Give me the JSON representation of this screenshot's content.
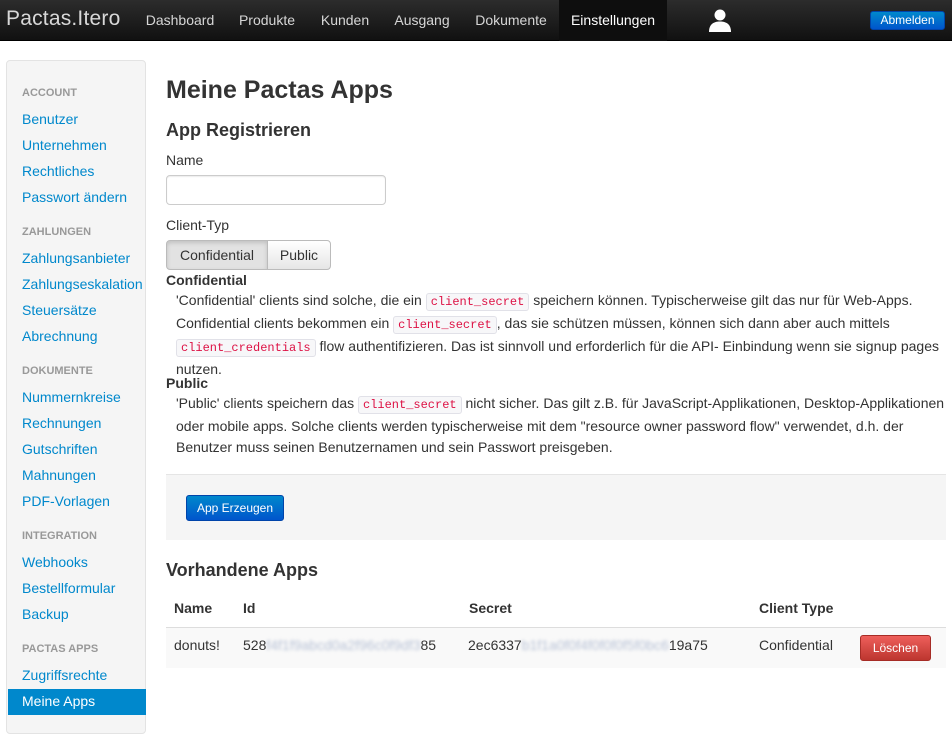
{
  "navbar": {
    "brand": "Pactas.Itero",
    "items": [
      "Dashboard",
      "Produkte",
      "Kunden",
      "Ausgang",
      "Dokumente",
      "Einstellungen"
    ],
    "active": "Einstellungen",
    "user_icon": "user-icon",
    "logout_label": "Abmelden"
  },
  "sidebar": {
    "sections": [
      {
        "header": "ACCOUNT",
        "items": [
          "Benutzer",
          "Unternehmen",
          "Rechtliches",
          "Passwort ändern"
        ]
      },
      {
        "header": "ZAHLUNGEN",
        "items": [
          "Zahlungsanbieter",
          "Zahlungseskalation",
          "Steuersätze",
          "Abrechnung"
        ]
      },
      {
        "header": "DOKUMENTE",
        "items": [
          "Nummernkreise",
          "Rechnungen",
          "Gutschriften",
          "Mahnungen",
          "PDF-Vorlagen"
        ]
      },
      {
        "header": "INTEGRATION",
        "items": [
          "Webhooks",
          "Bestellformular",
          "Backup"
        ]
      },
      {
        "header": "PACTAS APPS",
        "items": [
          "Zugriffsrechte",
          "Meine Apps"
        ]
      }
    ],
    "active": "Meine Apps"
  },
  "page": {
    "title": "Meine Pactas Apps",
    "register_heading": "App Registrieren",
    "name_label": "Name",
    "name_value": "",
    "client_type_label": "Client-Typ",
    "client_type_options": [
      "Confidential",
      "Public"
    ],
    "client_type_selected": "Confidential",
    "confidential": {
      "title": "Confidential",
      "t1": "'Confidential' clients sind solche, die ein ",
      "code1": "client_secret",
      "t2": " speichern können. Typischerweise gilt das nur für Web-Apps. Confidential clients bekommen ein ",
      "code2": "client_secret",
      "t3": ", das sie schützen müssen, können sich dann aber auch mittels ",
      "code3": "client_credentials",
      "t4": " flow authentifizieren. Das ist sinnvoll und erforderlich für die API- Einbindung wenn sie signup pages nutzen."
    },
    "public": {
      "title": "Public",
      "t1": "'Public' clients speichern das ",
      "code1": "client_secret",
      "t2": " nicht sicher. Das gilt z.B. für JavaScript-Applikationen, Desktop-Applikationen oder mobile apps. Solche clients werden typischerweise mit dem \"resource owner password flow\" verwendet, d.h. der Benutzer muss seinen Benutzernamen und sein Passwort preisgeben."
    },
    "create_button": "App Erzeugen",
    "existing_heading": "Vorhandene Apps",
    "table": {
      "headers": [
        "Name",
        "Id",
        "Secret",
        "Client Type"
      ],
      "rows": [
        {
          "name": "donuts!",
          "id_start": "528",
          "id_hidden": "f4f1f9abcd0a2f96c0f9df3",
          "id_end": "85",
          "secret_start": "2ec6337",
          "secret_hidden": "b1f1a0f0f4f0f0f0f5f0bc6",
          "secret_end": "19a75",
          "client_type": "Confidential",
          "delete_label": "Löschen"
        }
      ]
    }
  }
}
